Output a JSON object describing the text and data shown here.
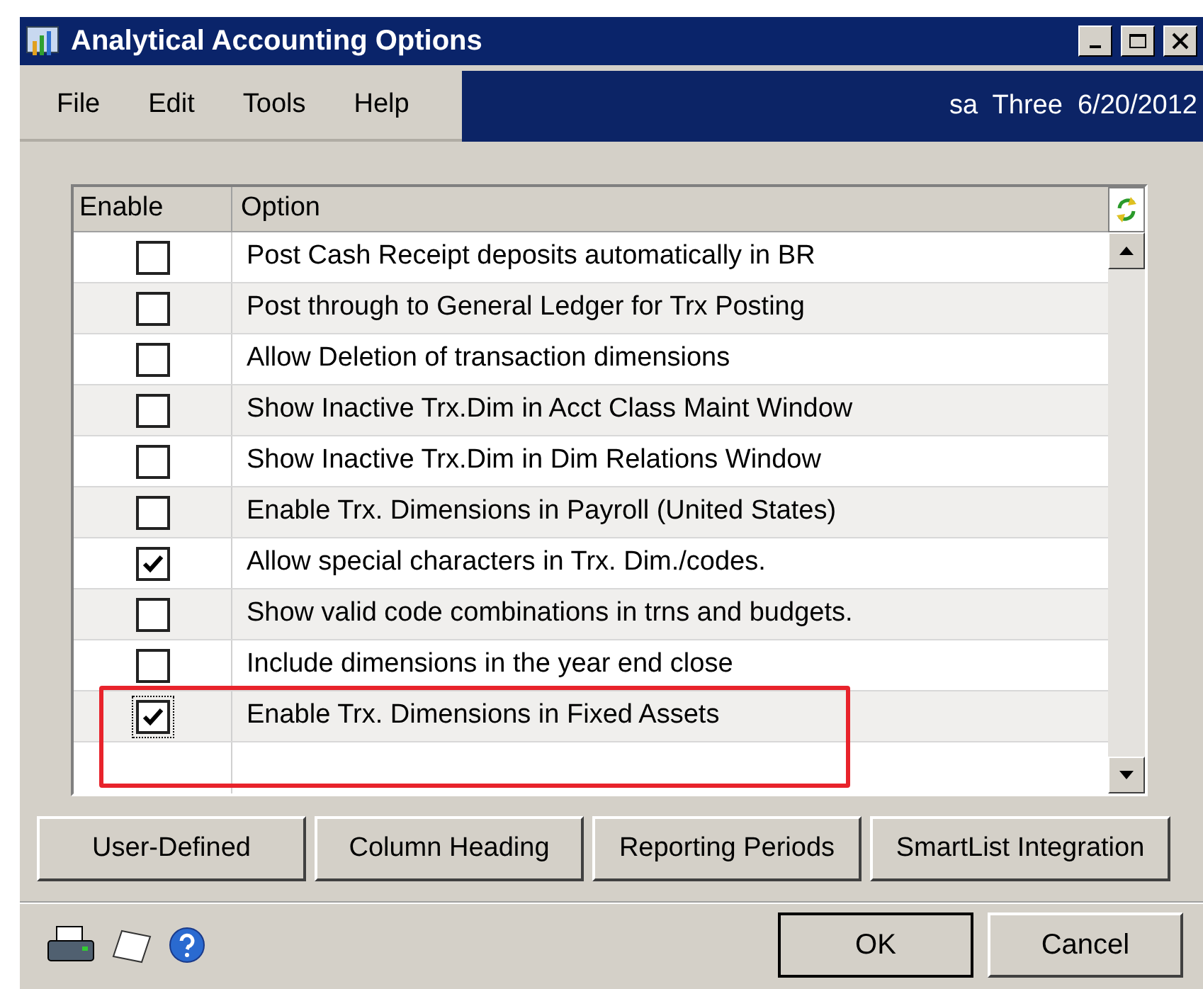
{
  "window": {
    "title": "Analytical Accounting Options"
  },
  "menu": [
    "File",
    "Edit",
    "Tools",
    "Help"
  ],
  "user_info": "sa  Three  6/20/2012",
  "table": {
    "columns": [
      "Enable",
      "Option"
    ],
    "rows": [
      {
        "enabled": false,
        "option": "Post Cash Receipt deposits automatically in BR",
        "focused": false
      },
      {
        "enabled": false,
        "option": "Post through to General Ledger for Trx Posting",
        "focused": false
      },
      {
        "enabled": false,
        "option": "Allow Deletion of transaction dimensions",
        "focused": false
      },
      {
        "enabled": false,
        "option": "Show Inactive Trx.Dim in Acct Class Maint Window",
        "focused": false
      },
      {
        "enabled": false,
        "option": "Show Inactive Trx.Dim in Dim Relations Window",
        "focused": false
      },
      {
        "enabled": false,
        "option": "Enable Trx. Dimensions in Payroll (United States)",
        "focused": false
      },
      {
        "enabled": true,
        "option": "Allow special characters in Trx. Dim./codes.",
        "focused": false
      },
      {
        "enabled": false,
        "option": "Show valid code combinations in trns and budgets.",
        "focused": false
      },
      {
        "enabled": false,
        "option": "Include dimensions in the year end close",
        "focused": false
      },
      {
        "enabled": true,
        "option": "Enable Trx. Dimensions in Fixed Assets",
        "focused": true
      }
    ]
  },
  "annotation": {
    "kind": "frame"
  },
  "buttons": [
    "User-Defined",
    "Column Heading",
    "Reporting Periods",
    "SmartList Integration"
  ],
  "footer_buttons": [
    "OK",
    "Cancel"
  ]
}
